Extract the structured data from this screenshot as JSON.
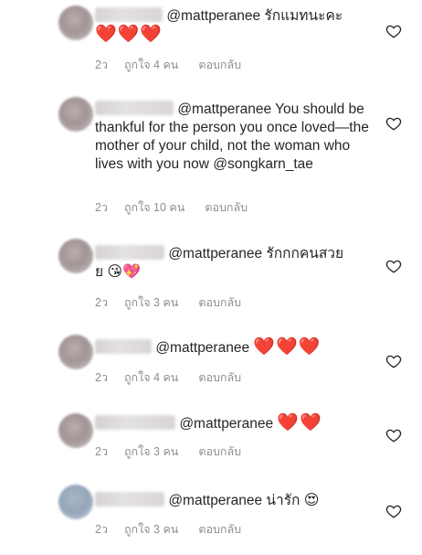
{
  "comments": [
    {
      "mention": "@mattperanee",
      "text": "รักแมทนะคะ",
      "hearts": "❤️❤️❤️",
      "age": "2ว",
      "likes": "ถูกใจ 4 คน",
      "reply": "ตอบกลับ"
    },
    {
      "mention": "@mattperanee",
      "text": "You should be thankful for the person you once loved—the mother of your child, not the woman who lives with you now",
      "mention2": "@songkarn_tae",
      "age": "2ว",
      "likes": "ถูกใจ 10 คน",
      "reply": "ตอบกลับ"
    },
    {
      "mention": "@mattperanee",
      "text": "รักกกคนสวย",
      "text_cont": "ย",
      "emoji": "😘💖",
      "age": "2ว",
      "likes": "ถูกใจ 3 คน",
      "reply": "ตอบกลับ"
    },
    {
      "mention": "@mattperanee",
      "hearts": "❤️❤️❤️",
      "age": "2ว",
      "likes": "ถูกใจ 4 คน",
      "reply": "ตอบกลับ"
    },
    {
      "mention": "@mattperanee",
      "hearts": "❤️❤️",
      "age": "2ว",
      "likes": "ถูกใจ 3 คน",
      "reply": "ตอบกลับ"
    },
    {
      "mention": "@mattperanee",
      "text": "น่ารัก",
      "emoji": "😍",
      "age": "2ว",
      "likes": "ถูกใจ 3 คน",
      "reply": "ตอบกลับ"
    }
  ],
  "icons": {
    "like": "heart-outline-icon"
  },
  "colors": {
    "heart": "#e0162b",
    "meta": "#8e8e8e",
    "text": "#262626"
  }
}
